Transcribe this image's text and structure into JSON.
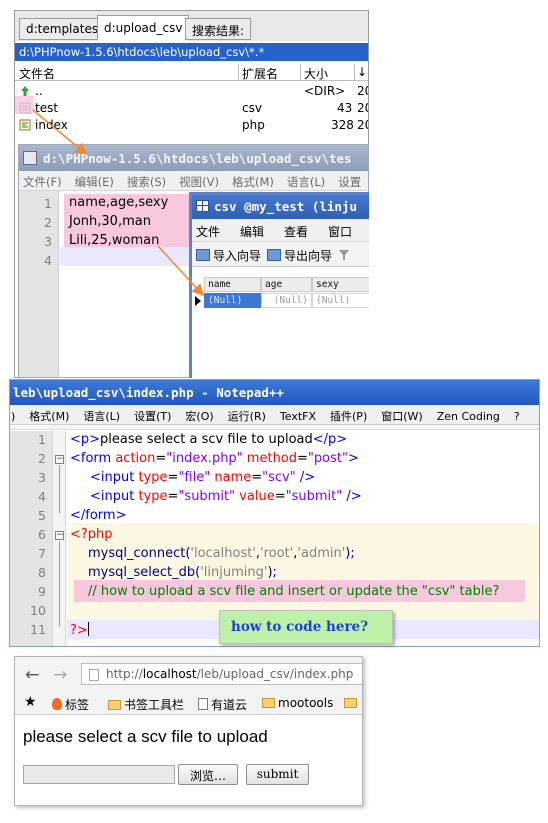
{
  "file_manager": {
    "tabs": [
      "d:templates",
      "d:upload_csv",
      "搜索结果:"
    ],
    "path": "d:\\PHPnow-1.5.6\\htdocs\\leb\\upload_csv\\*.*",
    "columns": [
      "文件名",
      "扩展名",
      "大小",
      "↓"
    ],
    "rows": [
      {
        "name": "..",
        "ext": "",
        "size": "<DIR>",
        "date": "20"
      },
      {
        "name": "test",
        "ext": "csv",
        "size": "43",
        "date": "20"
      },
      {
        "name": "index",
        "ext": "php",
        "size": "328",
        "date": "20"
      }
    ]
  },
  "notepad_csv": {
    "title": "d:\\PHPnow-1.5.6\\htdocs\\leb\\upload_csv\\tes",
    "menu": [
      "文件(F)",
      "编辑(E)",
      "搜索(S)",
      "视图(V)",
      "格式(M)",
      "语言(L)",
      "设置"
    ],
    "lines": [
      {
        "n": "1",
        "text": "name,age,sexy"
      },
      {
        "n": "2",
        "text": "Jonh,30,man"
      },
      {
        "n": "3",
        "text": "Lili,25,woman"
      },
      {
        "n": "4",
        "text": ""
      }
    ]
  },
  "csv_table": {
    "title": "csv @my_test (linju",
    "menu": [
      "文件",
      "编辑",
      "查看",
      "窗口"
    ],
    "toolbar": [
      "导入向导",
      "导出向导"
    ],
    "columns": [
      "name",
      "age",
      "sexy"
    ],
    "row": [
      "(Null)",
      "(Null)",
      "(Null)"
    ]
  },
  "notepad_php": {
    "title": "leb\\upload_csv\\index.php - Notepad++",
    "menu": [
      ")",
      "格式(M)",
      "语言(L)",
      "设置(T)",
      "宏(O)",
      "运行(R)",
      "TextFX",
      "插件(P)",
      "窗口(W)",
      "Zen Coding",
      "?"
    ],
    "line_numbers": [
      "1",
      "2",
      "3",
      "4",
      "5",
      "6",
      "7",
      "8",
      "9",
      "10",
      "11"
    ],
    "code": {
      "l1_open": "<p>",
      "l1_text": "please select a scv file to upload",
      "l1_close": "</p>",
      "l2_tag": "<form",
      "l2_attr1": " action",
      "l2_eq1": "=",
      "l2_val1": "\"index.php\"",
      "l2_attr2": " method",
      "l2_eq2": "=",
      "l2_val2": "\"post\"",
      "l2_end": ">",
      "l3_tag": "<input",
      "l3_attr1": " type",
      "l3_eq1": "=",
      "l3_val1": "\"file\"",
      "l3_attr2": " name",
      "l3_eq2": "=",
      "l3_val2": "\"scv\"",
      "l3_end": "  />",
      "l4_tag": "<input",
      "l4_attr1": " type",
      "l4_eq1": "=",
      "l4_val1": "\"submit\"",
      "l4_attr2": " value",
      "l4_eq2": "=",
      "l4_val2": "\"submit\"",
      "l4_end": " />",
      "l5": "</form>",
      "l6": "<?php",
      "l7_fn": "mysql_connect(",
      "l7_a": "'localhost'",
      "l7_c1": ",",
      "l7_b": "'root'",
      "l7_c2": ",",
      "l7_c": "'admin'",
      "l7_end": ");",
      "l8_fn": "mysql_select_db(",
      "l8_a": "'linjuming'",
      "l8_end": ");",
      "l9": "// how to upload a scv file and insert or update the \"csv\" table?",
      "l11": "?>"
    }
  },
  "note": "how to code here?",
  "browser": {
    "back": "←",
    "forward": "→",
    "url_prefix": "http://",
    "url_host": "localhost",
    "url_path": "/leb/upload_csv/index.php",
    "star": "★",
    "bookmarks": [
      "标签",
      "书签工具栏",
      "有道云",
      "mootools"
    ],
    "heading": "please select a scv file to upload",
    "browse_label": "浏览…",
    "submit_label": "submit"
  },
  "colors": {
    "pink_highlight": "#f7c8de",
    "note_bg": "#bff0a8",
    "note_text": "#1e3fd8",
    "arrow": "#f08a2c"
  }
}
